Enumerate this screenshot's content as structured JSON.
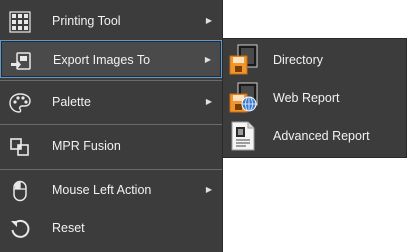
{
  "menu": {
    "items": [
      {
        "label": "Printing Tool",
        "icon": "printing-tool-icon",
        "has_submenu": true
      },
      {
        "label": "Export Images To",
        "icon": "export-images-icon",
        "has_submenu": true
      },
      {
        "label": "Palette",
        "icon": "palette-icon",
        "has_submenu": true
      },
      {
        "label": "MPR Fusion",
        "icon": "mpr-fusion-icon",
        "has_submenu": false
      },
      {
        "label": "Mouse Left Action",
        "icon": "mouse-icon",
        "has_submenu": true
      },
      {
        "label": "Reset",
        "icon": "reset-icon",
        "has_submenu": false
      }
    ],
    "selected": "Export Images To",
    "arrow": "▶"
  },
  "submenu": {
    "items": [
      {
        "label": "Directory",
        "icon": "directory-icon"
      },
      {
        "label": "Web Report",
        "icon": "web-report-icon"
      },
      {
        "label": "Advanced Report",
        "icon": "advanced-report-icon"
      }
    ]
  },
  "colors": {
    "menu_bg": "#3c3c3c",
    "text": "#f2f2f2",
    "selection_border": "#5a9ad0",
    "accent_orange": "#f0962a"
  }
}
